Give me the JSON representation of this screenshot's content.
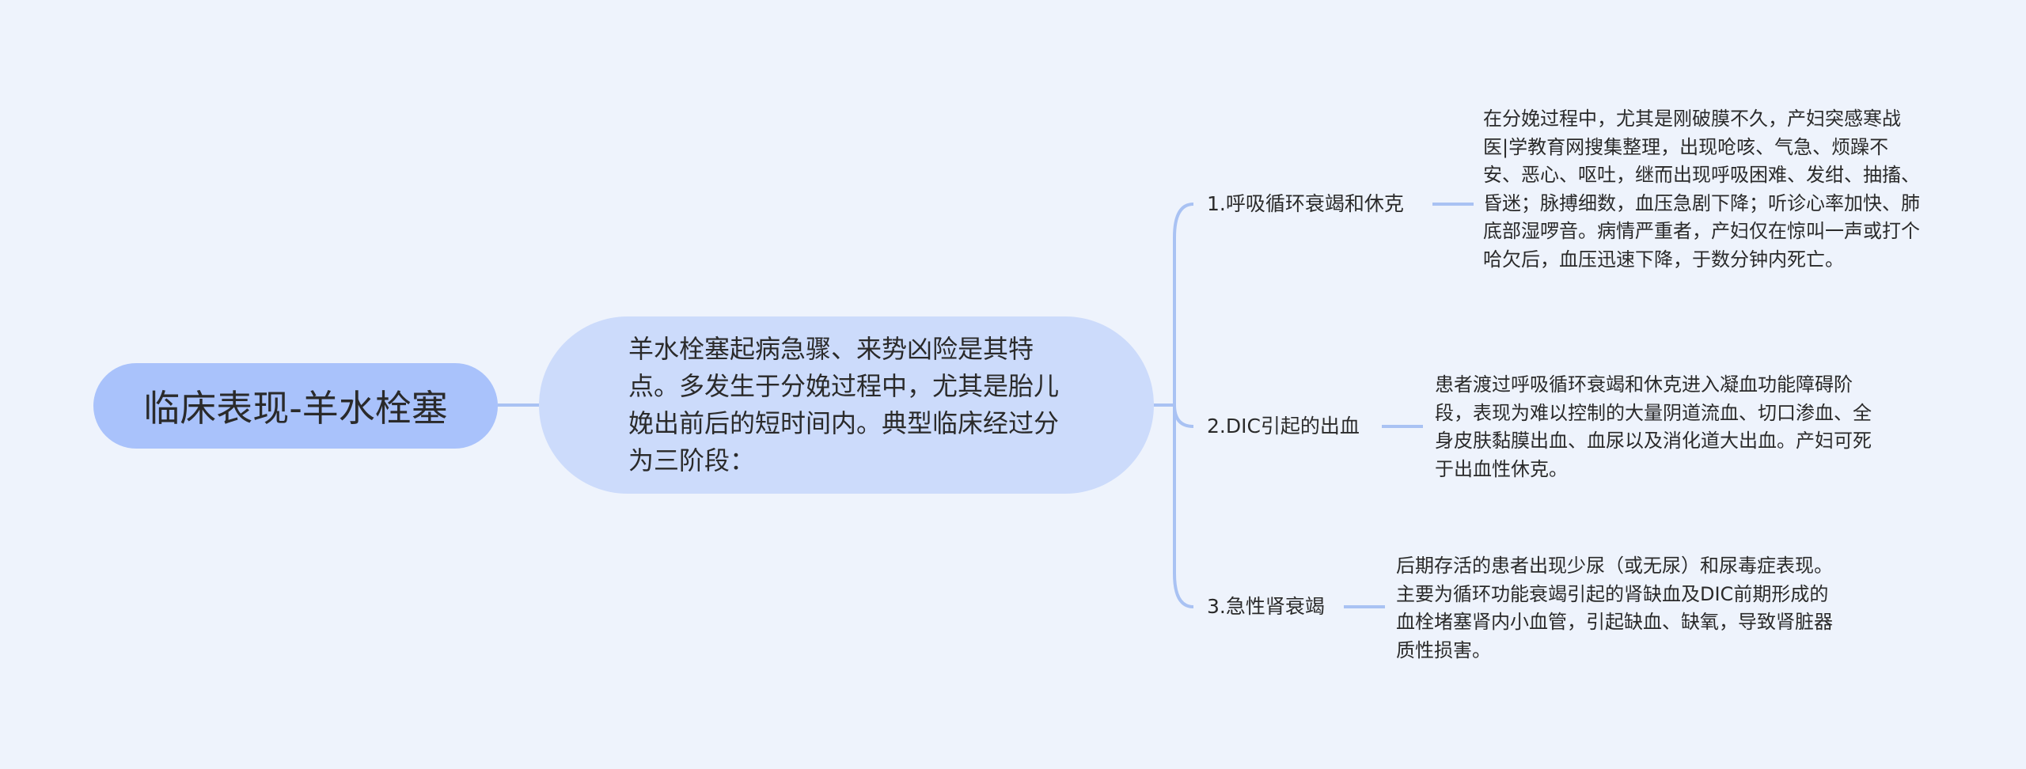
{
  "root": {
    "label": "临床表现-羊水栓塞"
  },
  "center": {
    "text": "羊水栓塞起病急骤、来势凶险是其特点。多发生于分娩过程中，尤其是胎儿娩出前后的短时间内。典型临床经过分为三阶段："
  },
  "branches": [
    {
      "label": "1.呼吸循环衰竭和休克",
      "detail": "在分娩过程中，尤其是刚破膜不久，产妇突感寒战医|学教育网搜集整理，出现呛咳、气急、烦躁不安、恶心、呕吐，继而出现呼吸困难、发绀、抽搐、昏迷；脉搏细数，血压急剧下降；听诊心率加快、肺底部湿啰音。病情严重者，产妇仅在惊叫一声或打个哈欠后，血压迅速下降，于数分钟内死亡。"
    },
    {
      "label": "2.DIC引起的出血",
      "detail": "患者渡过呼吸循环衰竭和休克进入凝血功能障碍阶段，表现为难以控制的大量阴道流血、切口渗血、全身皮肤黏膜出血、血尿以及消化道大出血。产妇可死于出血性休克。"
    },
    {
      "label": "3.急性肾衰竭",
      "detail": "后期存活的患者出现少尿（或无尿）和尿毒症表现。主要为循环功能衰竭引起的肾缺血及DIC前期形成的血栓堵塞肾内小血管，引起缺血、缺氧，导致肾脏器质性损害。"
    }
  ],
  "colors": {
    "background": "#eef3fc",
    "root": "#a9c2fb",
    "center": "#ccdbfb",
    "link": "#a9c2f3"
  }
}
